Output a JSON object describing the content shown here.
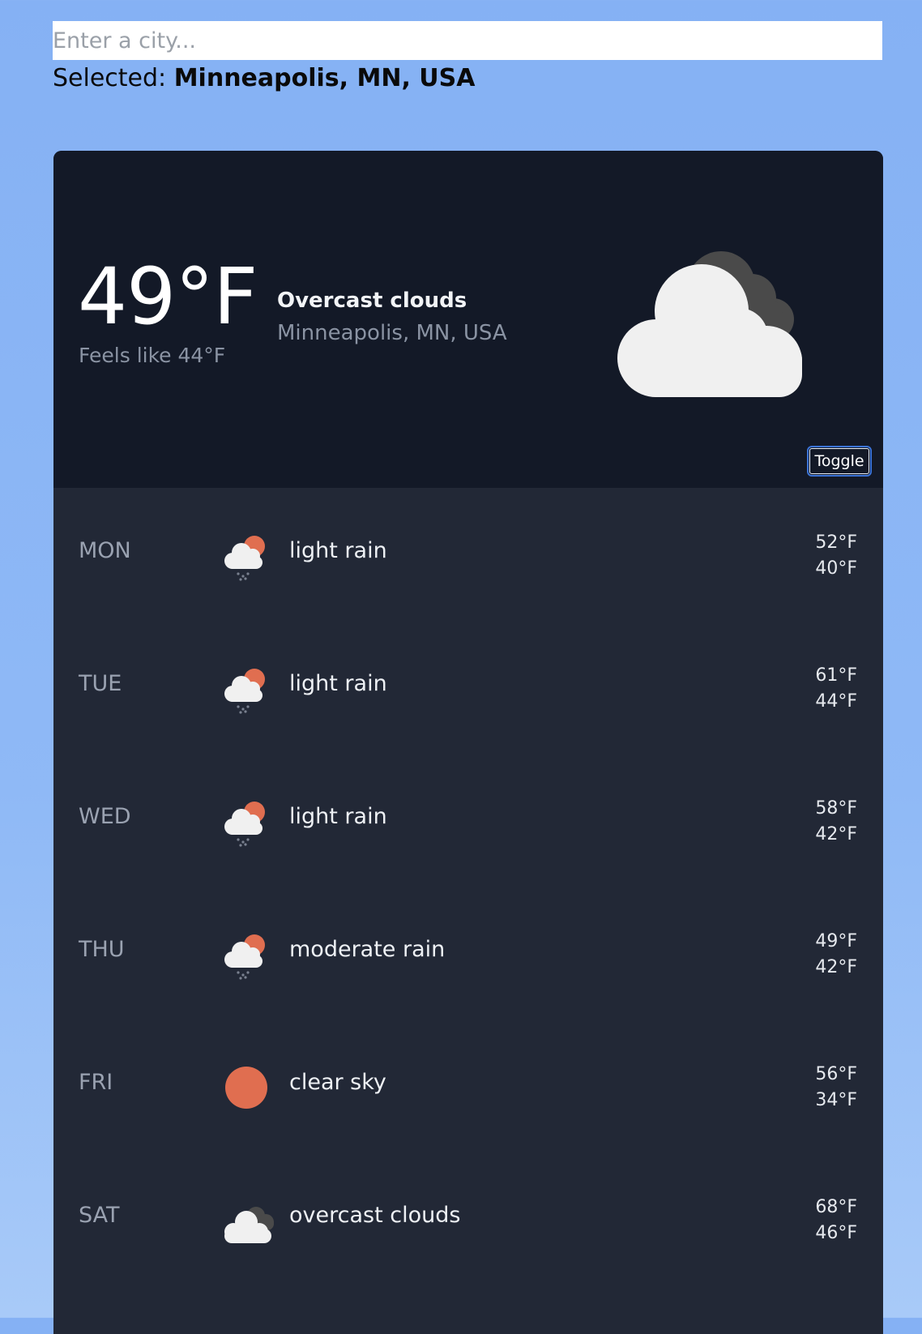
{
  "search": {
    "placeholder": "Enter a city...",
    "value": ""
  },
  "selection": {
    "prefix": "Selected:",
    "city": "Minneapolis, MN, USA"
  },
  "current": {
    "temperature": "49°F",
    "feels_like": "Feels like 44°F",
    "condition": "Overcast clouds",
    "location": "Minneapolis, MN, USA",
    "icon": "overcast-clouds-icon",
    "toggle_label": "Toggle"
  },
  "forecast": [
    {
      "day": "MON",
      "icon": "light-rain-icon",
      "description": "light rain",
      "high": "52°F",
      "low": "40°F"
    },
    {
      "day": "TUE",
      "icon": "light-rain-icon",
      "description": "light rain",
      "high": "61°F",
      "low": "44°F"
    },
    {
      "day": "WED",
      "icon": "light-rain-icon",
      "description": "light rain",
      "high": "58°F",
      "low": "42°F"
    },
    {
      "day": "THU",
      "icon": "moderate-rain-icon",
      "description": "moderate rain",
      "high": "49°F",
      "low": "42°F"
    },
    {
      "day": "FRI",
      "icon": "clear-sky-icon",
      "description": "clear sky",
      "high": "56°F",
      "low": "34°F"
    },
    {
      "day": "SAT",
      "icon": "overcast-clouds-icon",
      "description": "overcast clouds",
      "high": "68°F",
      "low": "46°F"
    }
  ],
  "colors": {
    "page_background": "#85b1f4",
    "current_panel": "#131927",
    "forecast_panel": "#222836",
    "sun": "#e06e50",
    "cloud_light": "#f0f0f0",
    "cloud_dark": "#4a4a4a",
    "toggle_border": "#3b73d6"
  }
}
